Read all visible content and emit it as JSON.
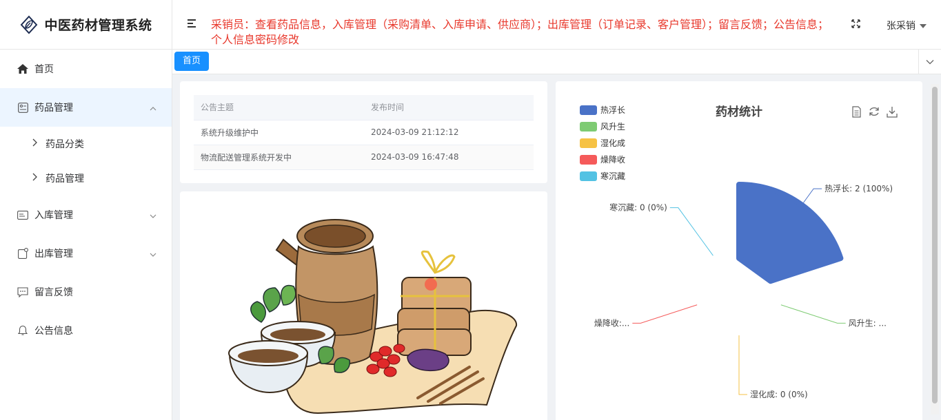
{
  "app": {
    "title": "中医药材管理系统"
  },
  "sidebar": {
    "items": [
      {
        "label": "首页",
        "icon": "home-icon"
      },
      {
        "label": "药品管理",
        "icon": "medicine-icon",
        "expanded": true,
        "children": [
          {
            "label": "药品分类"
          },
          {
            "label": "药品管理"
          }
        ]
      },
      {
        "label": "入库管理",
        "icon": "inbound-icon",
        "expanded": false
      },
      {
        "label": "出库管理",
        "icon": "outbound-icon",
        "expanded": false
      },
      {
        "label": "留言反馈",
        "icon": "message-icon"
      },
      {
        "label": "公告信息",
        "icon": "bell-icon"
      }
    ]
  },
  "header": {
    "role_line1": "采销员：查看药品信息，入库管理（采购清单、入库申请、供应商）；出库管理（订单记录、客户管理）；留言反馈；公告信息；",
    "role_line2": "个人信息密码修改",
    "fullscreen_icon": "fullscreen-icon",
    "user": "张采销"
  },
  "tags": {
    "active": "首页"
  },
  "notice": {
    "columns": [
      "公告主题",
      "发布时间"
    ],
    "rows": [
      {
        "title": "系统升级维护中",
        "time": "2024-03-09 21:12:12"
      },
      {
        "title": "物流配送管理系统开发中",
        "time": "2024-03-09 16:47:48"
      }
    ]
  },
  "chart_data": {
    "type": "pie",
    "title": "药材统计",
    "legend_position": "top-left",
    "toolbox": [
      "data-view-icon",
      "restore-icon",
      "save-image-icon"
    ],
    "categories": [
      "热浮长",
      "风升生",
      "湿化成",
      "燥降收",
      "寒沉藏"
    ],
    "values": [
      2,
      0,
      0,
      0,
      0
    ],
    "colors": [
      "#4a72c7",
      "#7ecb73",
      "#f6c244",
      "#f55a5a",
      "#53c2e3"
    ],
    "labels": [
      "热浮长: 2 (100%)",
      "风升生: ...",
      "湿化成: 0 (0%)",
      "燥降收:...",
      "寒沉藏: 0 (0%)"
    ],
    "rose_type": "area"
  }
}
